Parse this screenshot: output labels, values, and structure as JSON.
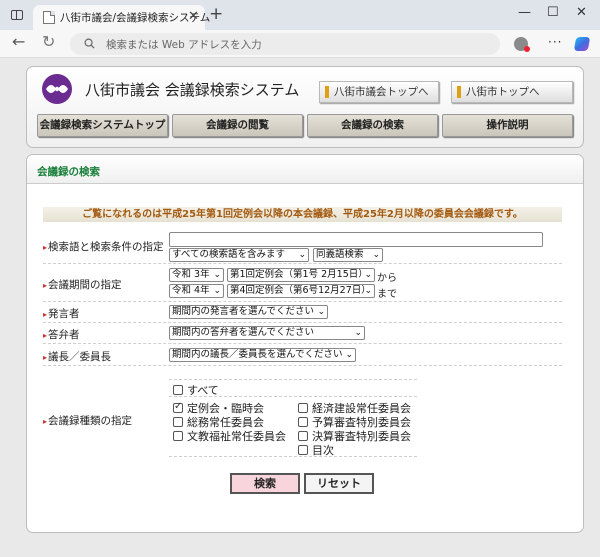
{
  "browser": {
    "tab_title": "八街市議会/会議録検索システム",
    "address_placeholder": "検索または Web アドレスを入力",
    "new_tab": "+",
    "tab_close": "✕",
    "minimize": "—",
    "maximize": "☐",
    "close": "✕"
  },
  "header": {
    "title": "八街市議会 会議録検索システム",
    "links": [
      "八街市議会トップへ",
      "八街市トップへ"
    ],
    "menu": [
      "会議録検索システムトップ",
      "会議録の閲覧",
      "会議録の検索",
      "操作説明"
    ]
  },
  "search": {
    "section_title": "会議録の検索",
    "notice": "ご覧になれるのは平成25年第1回定例会以降の本会議録、平成25年2月以降の委員会会議録です。",
    "keyword": {
      "label": "検索語と検索条件の指定",
      "value": "",
      "mode": "すべての検索語を含みます",
      "synonym": "同義語検索"
    },
    "period": {
      "label": "会議期間の指定",
      "from_year": "令和 3年",
      "from_session": "第1回定例会（第1号 2月15日）",
      "from_suffix": "から",
      "to_year": "令和 4年",
      "to_session": "第4回定例会（第6号12月27日）",
      "to_suffix": "まで"
    },
    "speaker": {
      "label": "発言者",
      "value": "期間内の発言者を選んでください"
    },
    "answerer": {
      "label": "答弁者",
      "value": "期間内の答弁者を選んでください"
    },
    "chair": {
      "label": "議長／委員長",
      "value": "期間内の議長／委員長を選んでください"
    },
    "types": {
      "label": "会議録種類の指定",
      "all": {
        "label": "すべて",
        "checked": false
      },
      "left": [
        {
          "label": "定例会・臨時会",
          "checked": true
        },
        {
          "label": "総務常任委員会",
          "checked": false
        },
        {
          "label": "文教福祉常任委員会",
          "checked": false
        }
      ],
      "right": [
        {
          "label": "経済建設常任委員会",
          "checked": false
        },
        {
          "label": "予算審査特別委員会",
          "checked": false
        },
        {
          "label": "決算審査特別委員会",
          "checked": false
        },
        {
          "label": "目次",
          "checked": false
        }
      ]
    },
    "buttons": {
      "search": "検索",
      "reset": "リセット"
    }
  },
  "colors": {
    "section_title": "#19803a",
    "notice_text": "#a35a10",
    "search_button_bg": "#f8d4dc",
    "logo": "#6b2c91"
  }
}
